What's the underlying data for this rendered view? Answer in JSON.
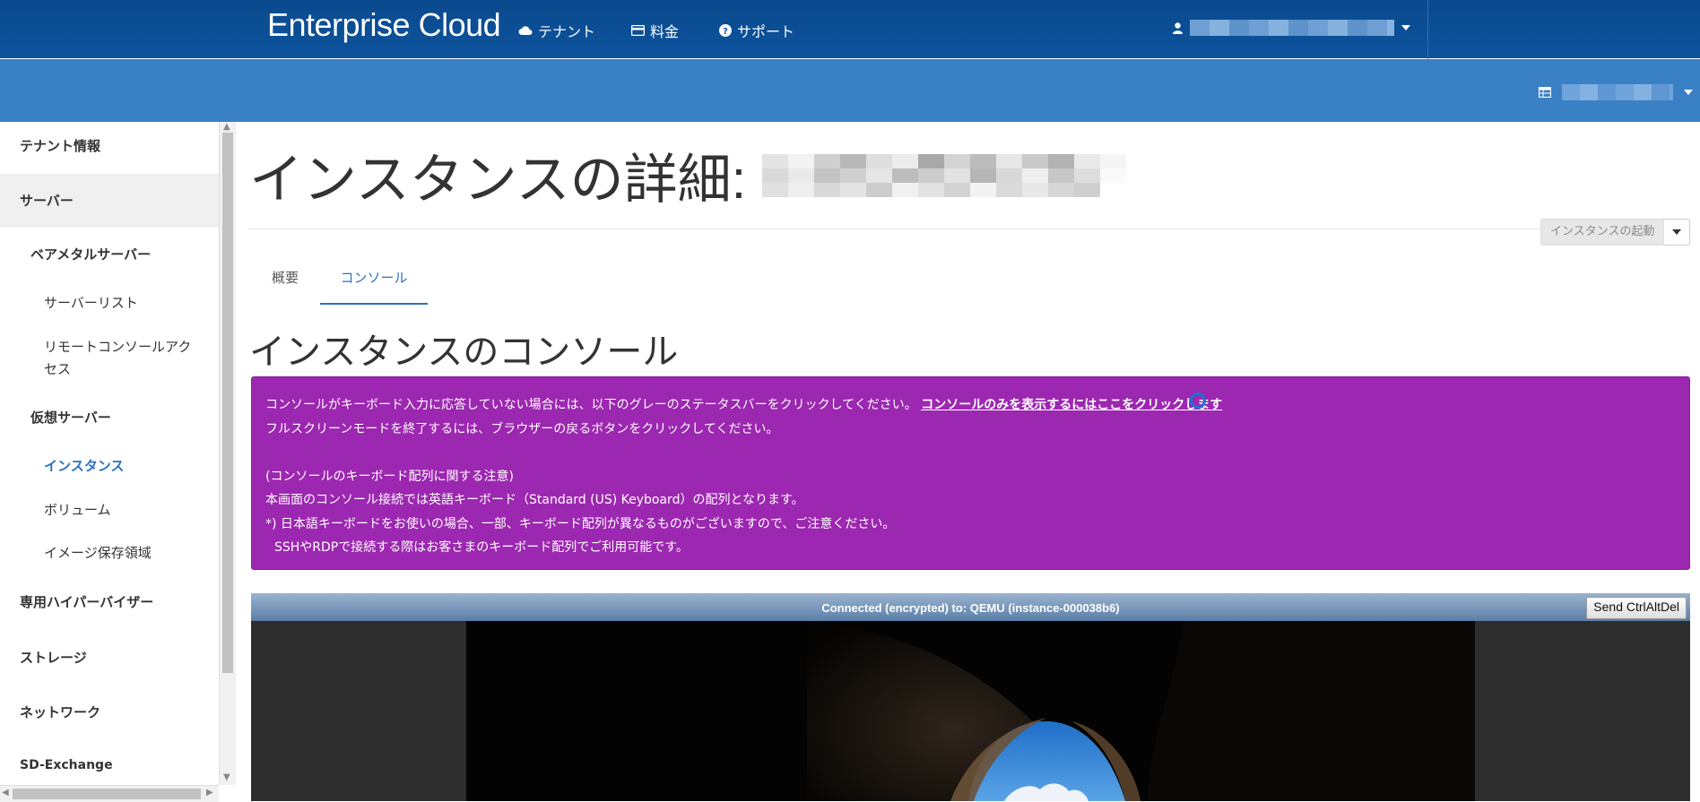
{
  "topnav": {
    "brand": "Enterprise Cloud",
    "items": [
      {
        "label": "テナント",
        "icon": "cloud-icon"
      },
      {
        "label": "料金",
        "icon": "credit-card-icon"
      },
      {
        "label": "サポート",
        "icon": "question-circle-icon"
      }
    ],
    "user_icon": "user-icon"
  },
  "subbar": {
    "region_icon": "table-icon"
  },
  "sidebar": {
    "items": [
      {
        "label": "テナント情報"
      },
      {
        "label": "サーバー"
      },
      {
        "label": "ベアメタルサーバー"
      },
      {
        "label": "サーバーリスト"
      },
      {
        "label": "リモートコンソールアク"
      },
      {
        "label": "セス"
      },
      {
        "label": "仮想サーバー"
      },
      {
        "label": "インスタンス"
      },
      {
        "label": "ボリューム"
      },
      {
        "label": "イメージ保存領域"
      },
      {
        "label": "専用ハイパーバイザー"
      },
      {
        "label": "ストレージ"
      },
      {
        "label": "ネットワーク"
      },
      {
        "label": "SD-Exchange"
      }
    ]
  },
  "main": {
    "title": "インスタンスの詳細:",
    "action_button": "インスタンスの起動",
    "tabs": [
      {
        "label": "概要"
      },
      {
        "label": "コンソール"
      }
    ],
    "section_title": "インスタンスのコンソール",
    "notice": {
      "line1": "コンソールがキーボード入力に応答していない場合には、以下のグレーのステータスバーをクリックしてください。",
      "line1_link": "コンソールのみを表示するにはここをクリックします",
      "line2": "フルスクリーンモードを終了するには、ブラウザーの戻るボタンをクリックしてください。",
      "line3": "",
      "line4": "(コンソールのキーボード配列に関する注意)",
      "line5": "本画面のコンソール接続では英語キーボード（Standard (US) Keyboard）の配列となります。",
      "line6": "*) 日本語キーボードをお使いの場合、一部、キーボード配列が異なるものがございますので、ご注意ください。",
      "line7": "SSHやRDPで接続する際はお客さまのキーボード配列でご利用可能です。"
    },
    "console": {
      "status": "Connected (encrypted) to: QEMU (instance-000038b6)",
      "send_button": "Send CtrlAltDel"
    }
  }
}
